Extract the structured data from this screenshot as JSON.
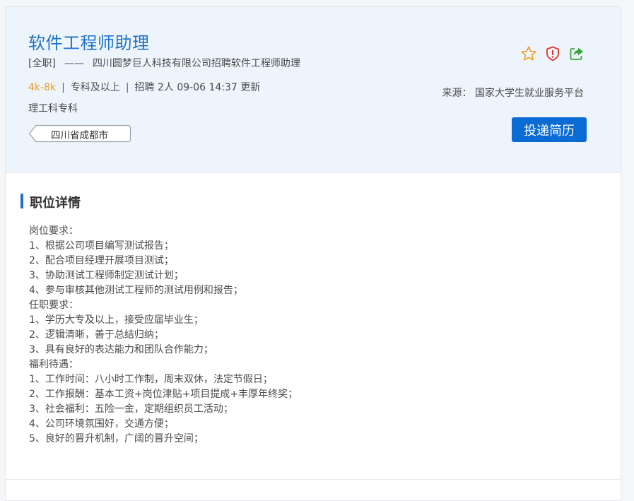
{
  "job": {
    "title": "软件工程师助理",
    "type": "[全职]",
    "dash": "——",
    "company_line": "四川圆梦巨人科技有限公司招聘软件工程师助理",
    "salary": "4k-8k",
    "sep": "|",
    "education": "专科及以上",
    "recruit": "招聘 2人",
    "updated": "09-06 14:37 更新",
    "major": "理工科专科",
    "location": "四川省成都市"
  },
  "source": {
    "text": "来源：  国家大学生就业服务平台"
  },
  "actions": {
    "apply_label": "投递简历",
    "icons": [
      "star-icon",
      "report-shield-icon",
      "share-icon"
    ],
    "colors": {
      "star": "#f39b1f",
      "report": "#e0352b",
      "share": "#3aa33a",
      "apply": "#0a6bd4"
    }
  },
  "section": {
    "title": "职位详情"
  },
  "details": [
    "岗位要求：",
    "1、根据公司项目编写测试报告；",
    "2、配合项目经理开展项目测试；",
    "3、协助测试工程师制定测试计划；",
    "4、参与审核其他测试工程师的测试用例和报告；",
    "任职要求：",
    "1、学历大专及以上，接受应届毕业生；",
    "2、逻辑清晰，善于总结归纳；",
    "3、具有良好的表达能力和团队合作能力；",
    "福利待遇：",
    "1、工作时间：八小时工作制，周末双休，法定节假日；",
    "2、工作报酬：基本工资+岗位津贴+项目提成+丰厚年终奖；",
    "3、社会福利：五险一金，定期组织员工活动；",
    "4、公司环境氛围好，交通方便；",
    "5、良好的晋升机制，广阔的晋升空间；"
  ]
}
